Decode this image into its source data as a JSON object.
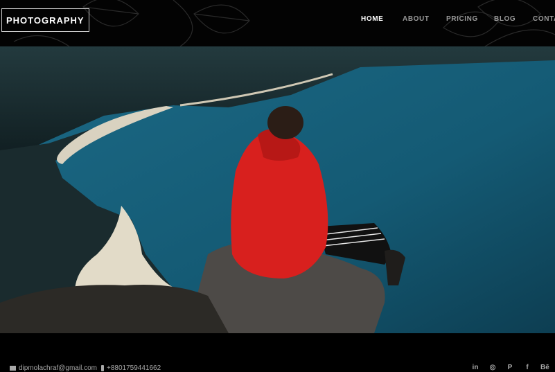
{
  "header": {
    "logo_text": "PHOTOGRAPHY",
    "nav": [
      {
        "label": "HOME",
        "active": true
      },
      {
        "label": "ABOUT",
        "active": false
      },
      {
        "label": "PRICING",
        "active": false
      },
      {
        "label": "BLOG",
        "active": false
      },
      {
        "label": "CONTA",
        "active": false
      }
    ]
  },
  "hero": {
    "image_subject": "person-in-red-jacket-sitting-on-cliff-over-bay"
  },
  "footer": {
    "email": "dipmolachraf@gmail.com",
    "phone": "+8801759441662",
    "social_icons": [
      "linkedin-icon",
      "instagram-icon",
      "pinterest-icon",
      "facebook-icon",
      "behance-icon"
    ],
    "social_glyphs": [
      "in",
      "◎",
      "P",
      "f",
      "Bē"
    ]
  },
  "colors": {
    "background": "#000000",
    "nav_active": "#ffffff",
    "nav_inactive": "#9a9a9a",
    "jacket_red": "#d8201e",
    "sea_blue": "#13566f"
  }
}
